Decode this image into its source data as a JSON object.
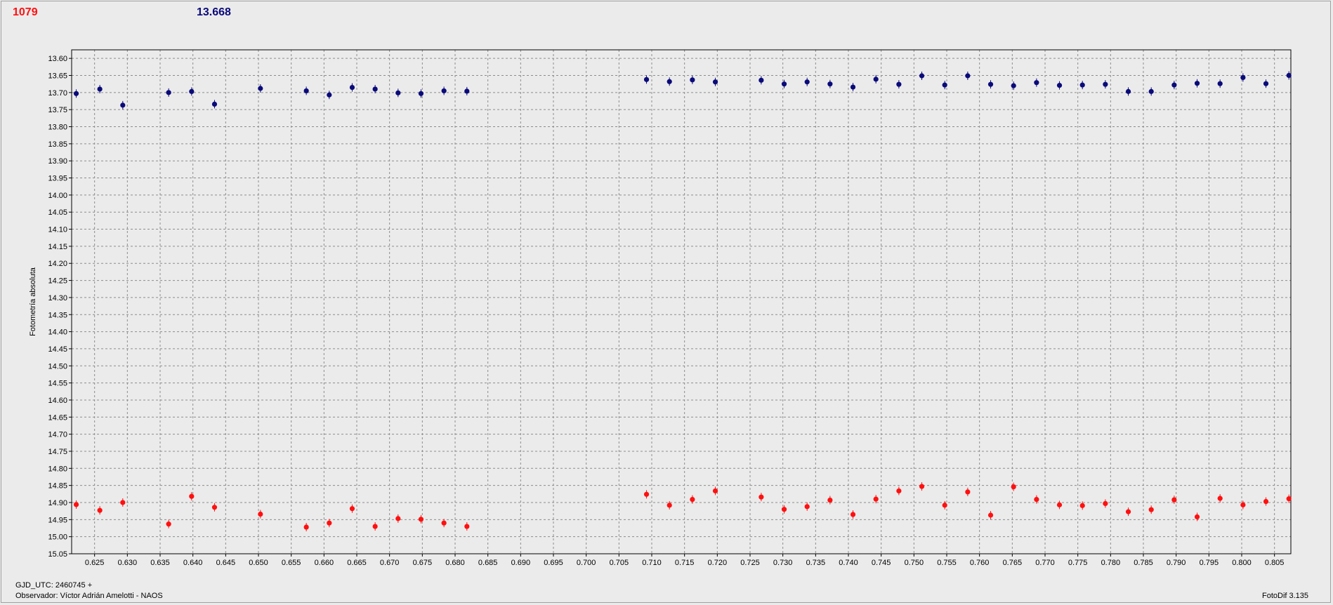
{
  "header": {
    "left_value": "1079",
    "right_value": "13.668"
  },
  "footer": {
    "gjd": "GJD_UTC: 2460745 +",
    "observer": "Observador: Víctor Adrián Amelotti - NAOS",
    "software": "FotoDif 3.135"
  },
  "colors": {
    "series_blue": "#0a0a7a",
    "series_red": "#ff1010",
    "grid": "#8c8c8c",
    "plot_bg": "#ebebeb"
  },
  "chart_data": {
    "type": "scatter",
    "ylabel": "Fotometría absoluta",
    "y_inverted": true,
    "grid": true,
    "xlim": [
      0.6215,
      0.8075
    ],
    "ylim": [
      13.575,
      15.05
    ],
    "x_ticks": [
      "0.625",
      "0.630",
      "0.635",
      "0.640",
      "0.645",
      "0.650",
      "0.655",
      "0.660",
      "0.665",
      "0.670",
      "0.675",
      "0.680",
      "0.685",
      "0.690",
      "0.695",
      "0.700",
      "0.705",
      "0.710",
      "0.715",
      "0.720",
      "0.725",
      "0.730",
      "0.735",
      "0.740",
      "0.745",
      "0.750",
      "0.755",
      "0.760",
      "0.765",
      "0.770",
      "0.775",
      "0.780",
      "0.785",
      "0.790",
      "0.795",
      "0.800",
      "0.805"
    ],
    "y_ticks": [
      "13.60",
      "13.65",
      "13.70",
      "13.75",
      "13.80",
      "13.85",
      "13.90",
      "13.95",
      "14.00",
      "14.05",
      "14.10",
      "14.15",
      "14.20",
      "14.25",
      "14.30",
      "14.35",
      "14.40",
      "14.45",
      "14.50",
      "14.55",
      "14.60",
      "14.65",
      "14.70",
      "14.75",
      "14.80",
      "14.85",
      "14.90",
      "14.95",
      "15.00",
      "15.05"
    ],
    "series": [
      {
        "color": "#0a0a7a",
        "x": [
          0.6222,
          0.6258,
          0.6293,
          0.6363,
          0.6398,
          0.6433,
          0.6503,
          0.6573,
          0.6608,
          0.6643,
          0.6678,
          0.6713,
          0.6748,
          0.6783,
          0.6818,
          0.7092,
          0.7127,
          0.7162,
          0.7197,
          0.7267,
          0.7302,
          0.7337,
          0.7372,
          0.7407,
          0.7442,
          0.7477,
          0.7512,
          0.7547,
          0.7582,
          0.7617,
          0.7652,
          0.7687,
          0.7722,
          0.7757,
          0.7792,
          0.7827,
          0.7862,
          0.7897,
          0.7932,
          0.7967,
          0.8002,
          0.8037,
          0.8072
        ],
        "y": [
          13.703,
          13.69,
          13.737,
          13.7,
          13.697,
          13.734,
          13.688,
          13.695,
          13.707,
          13.685,
          13.69,
          13.701,
          13.703,
          13.695,
          13.696,
          13.662,
          13.668,
          13.663,
          13.669,
          13.664,
          13.675,
          13.669,
          13.675,
          13.684,
          13.661,
          13.676,
          13.651,
          13.678,
          13.651,
          13.676,
          13.68,
          13.671,
          13.679,
          13.678,
          13.676,
          13.697,
          13.697,
          13.678,
          13.673,
          13.674,
          13.656,
          13.674,
          13.65
        ]
      },
      {
        "color": "#ff1010",
        "x": [
          0.6222,
          0.6258,
          0.6293,
          0.6363,
          0.6398,
          0.6433,
          0.6503,
          0.6573,
          0.6608,
          0.6643,
          0.6678,
          0.6713,
          0.6748,
          0.6783,
          0.6818,
          0.7092,
          0.7127,
          0.7162,
          0.7197,
          0.7267,
          0.7302,
          0.7337,
          0.7372,
          0.7407,
          0.7442,
          0.7477,
          0.7512,
          0.7547,
          0.7582,
          0.7617,
          0.7652,
          0.7687,
          0.7722,
          0.7757,
          0.7792,
          0.7827,
          0.7862,
          0.7897,
          0.7932,
          0.7967,
          0.8002,
          0.8037,
          0.8072
        ],
        "y": [
          14.906,
          14.923,
          14.9,
          14.963,
          14.882,
          14.914,
          14.934,
          14.972,
          14.96,
          14.918,
          14.97,
          14.947,
          14.949,
          14.96,
          14.97,
          14.876,
          14.908,
          14.891,
          14.866,
          14.884,
          14.92,
          14.912,
          14.893,
          14.935,
          14.89,
          14.866,
          14.853,
          14.908,
          14.869,
          14.937,
          14.854,
          14.891,
          14.907,
          14.909,
          14.903,
          14.927,
          14.921,
          14.892,
          14.942,
          14.888,
          14.907,
          14.897,
          14.889
        ]
      }
    ]
  }
}
